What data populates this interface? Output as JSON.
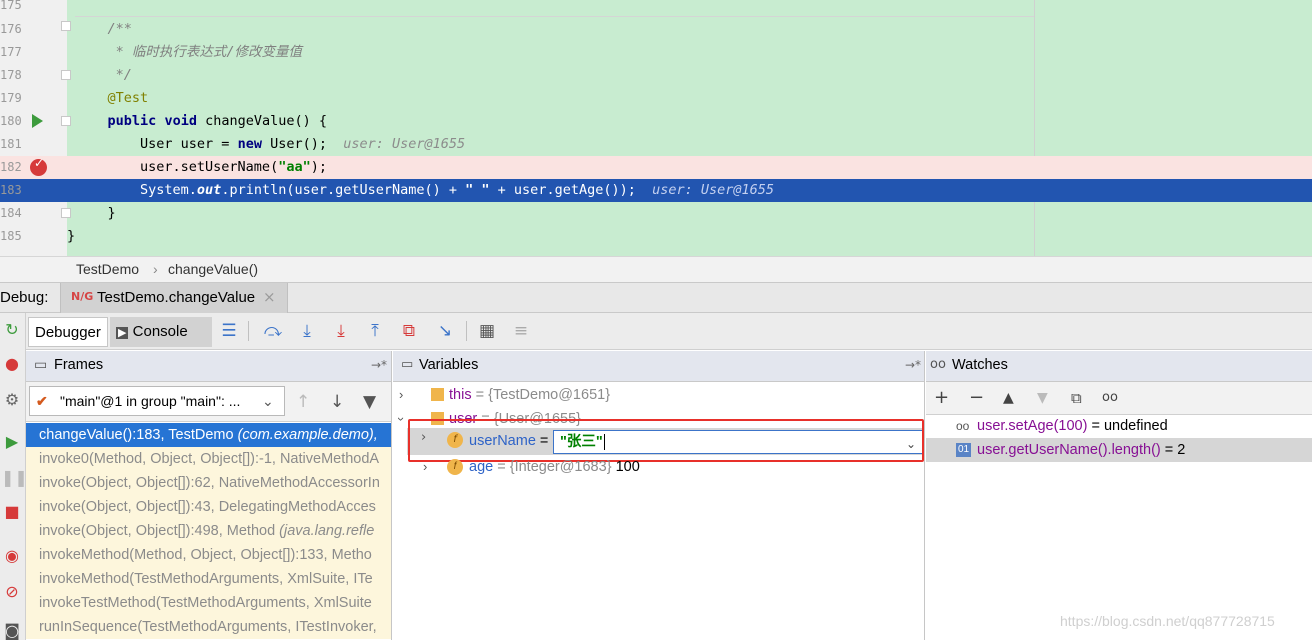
{
  "editor": {
    "lines": [
      {
        "num": "175",
        "html_kind": "blank",
        "text": ""
      },
      {
        "num": "176",
        "kind": "comment",
        "text": "    /**"
      },
      {
        "num": "177",
        "kind": "comment",
        "text": "     * 临时执行表达式/修改变量值"
      },
      {
        "num": "178",
        "kind": "comment",
        "text": "     */"
      },
      {
        "num": "179",
        "kind": "annotation",
        "text": "    @Test"
      },
      {
        "num": "180",
        "kind": "method",
        "kw1": "public",
        "kw2": "void",
        "rest": " changeValue() {"
      },
      {
        "num": "181",
        "kind": "decl",
        "pre": "        User user = ",
        "kw": "new",
        "post": " User();",
        "hint": "user: User@1655"
      },
      {
        "num": "182",
        "kind": "call",
        "pre": "        user.setUserName(",
        "str": "\"aa\"",
        "post": ");"
      },
      {
        "num": "183",
        "kind": "print",
        "pre": "        System.",
        "fld": "out",
        "mid": ".println(user.getUserName() + ",
        "str": "\" \"",
        "post": " + user.getAge());",
        "hint": "user: User@1655"
      },
      {
        "num": "184",
        "kind": "plain",
        "text": "    }"
      },
      {
        "num": "185",
        "kind": "plain",
        "text": "}"
      }
    ]
  },
  "breadcrumb": {
    "class_name": "TestDemo",
    "separator": "›",
    "method_name": "changeValue()"
  },
  "debug": {
    "title": "Debug:",
    "session_icon": "N/G",
    "session_tab": "TestDemo.changeValue",
    "close": "×"
  },
  "toolbar": {
    "debugger_tab": "Debugger",
    "console_tab": "Console",
    "console_icon": "▶",
    "pin": "→*"
  },
  "frames": {
    "title": "Frames",
    "pin": "→*",
    "thread": "\"main\"@1 in group \"main\": ...",
    "thread_check": "✔",
    "caret": "⌄",
    "items": [
      {
        "method": "changeValue():183, TestDemo",
        "pkg": "(com.example.demo),"
      },
      {
        "method": "invoke0(Method, Object, Object[]):-1, NativeMethodA",
        "pkg": ""
      },
      {
        "method": "invoke(Object, Object[]):62, NativeMethodAccessorIn",
        "pkg": ""
      },
      {
        "method": "invoke(Object, Object[]):43, DelegatingMethodAcces",
        "pkg": ""
      },
      {
        "method": "invoke(Object, Object[]):498, Method ",
        "pkg": "(java.lang.refle"
      },
      {
        "method": "invokeMethod(Method, Object, Object[]):133, Metho",
        "pkg": ""
      },
      {
        "method": "invokeMethod(TestMethodArguments, XmlSuite, ITe",
        "pkg": ""
      },
      {
        "method": "invokeTestMethod(TestMethodArguments, XmlSuite",
        "pkg": ""
      },
      {
        "method": "runInSequence(TestMethodArguments, ITestInvoker,",
        "pkg": ""
      }
    ]
  },
  "variables": {
    "title": "Variables",
    "pin": "→*",
    "rows": {
      "this_name": "this",
      "this_value": " = {TestDemo@1651}",
      "user_name": "user",
      "user_value": " = {User@1655}",
      "username_name": "userName",
      "username_eq": " =",
      "username_edit": "\"张三\"",
      "age_name": "age",
      "age_value": " = {Integer@1683} ",
      "age_num": "100"
    },
    "field_icon": "f",
    "expand_arrow": "›"
  },
  "watches": {
    "title": "Watches",
    "title_icon": "oo",
    "items": [
      {
        "icon": "oo",
        "expr": "user.setAge(100)",
        "result": " = undefined"
      },
      {
        "icon": "01",
        "expr": "user.getUserName().length()",
        "result": " = 2"
      }
    ]
  },
  "watermark": "https://blog.csdn.net/qq877728715"
}
